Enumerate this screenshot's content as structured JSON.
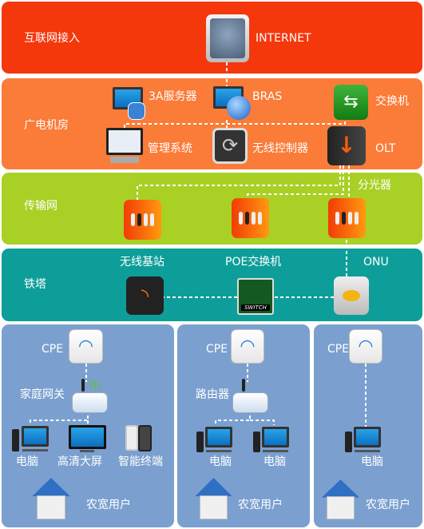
{
  "layers": {
    "internet_access": "互联网接入",
    "broadcast_room": "广电机房",
    "transport_network": "传输网",
    "tower": "铁塔"
  },
  "nodes": {
    "internet": "INTERNET",
    "aaa_server": "3A服务器",
    "bras": "BRAS",
    "switch": "交换机",
    "management_system": "管理系统",
    "wireless_controller": "无线控制器",
    "olt": "OLT",
    "splitter": "分光器",
    "base_station": "无线基站",
    "poe_switch": "POE交换机",
    "poe_switch_badge": "SWITCH",
    "onu": "ONU"
  },
  "users": [
    {
      "cpe": "CPE",
      "gateway": "家庭网关",
      "devices": [
        "电脑",
        "高清大屏",
        "智能终端"
      ],
      "user": "农宽用户"
    },
    {
      "cpe": "CPE",
      "gateway": "路由器",
      "devices": [
        "电脑",
        "电脑"
      ],
      "user": "农宽用户"
    },
    {
      "cpe": "CPE",
      "devices": [
        "电脑"
      ],
      "user": "农宽用户"
    }
  ],
  "colors": {
    "internet_band": "#f5370c",
    "room_band": "#fb7b38",
    "transport_band": "#a9d024",
    "tower_band": "#0e9e99",
    "user_panel": "#7ba0cf"
  }
}
